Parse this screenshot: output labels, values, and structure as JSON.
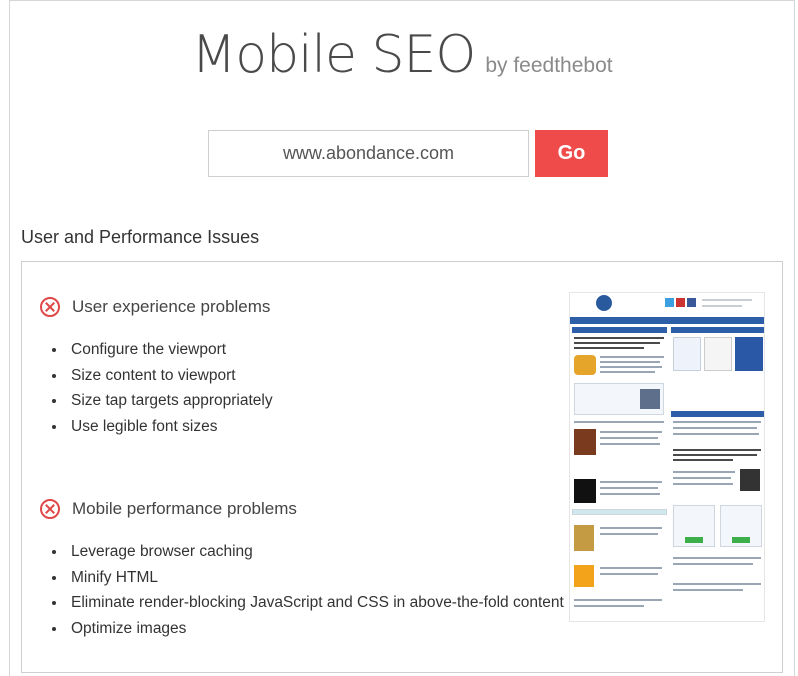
{
  "header": {
    "title": "Mobile SEO",
    "byline": "by feedthebot"
  },
  "search": {
    "url_value": "www.abondance.com",
    "go_label": "Go"
  },
  "section_title": "User and Performance Issues",
  "groups": [
    {
      "title": "User experience problems",
      "status_icon": "x-circle-icon",
      "items": [
        "Configure the viewport",
        "Size content to viewport",
        "Size tap targets appropriately",
        "Use legible font sizes"
      ]
    },
    {
      "title": "Mobile performance problems",
      "status_icon": "x-circle-icon",
      "items": [
        "Leverage browser caching",
        "Minify HTML",
        "Eliminate render-blocking JavaScript and CSS in above-the-fold content",
        "Optimize images"
      ]
    }
  ],
  "colors": {
    "accent": "#ef4b4b",
    "error": "#e04848",
    "thumbnail_nav": "#2d5ea8"
  }
}
